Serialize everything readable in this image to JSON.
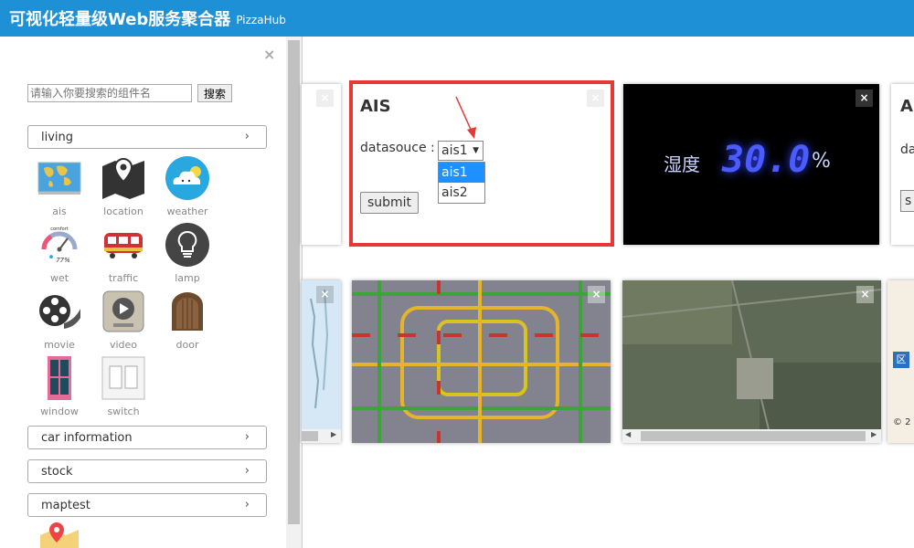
{
  "header": {
    "title": "可视化轻量级Web服务聚合器",
    "subtitle": "PizzaHub"
  },
  "sidebar": {
    "close_glyph": "×",
    "search": {
      "placeholder": "请输入你要搜索的组件名",
      "button": "搜索"
    },
    "categories": [
      {
        "label": "living",
        "chevron": "›"
      },
      {
        "label": "car information",
        "chevron": "›"
      },
      {
        "label": "stock",
        "chevron": "›"
      },
      {
        "label": "maptest",
        "chevron": "›"
      }
    ],
    "components": [
      {
        "label": "ais",
        "icon": "world-map-icon"
      },
      {
        "label": "location",
        "icon": "location-map-icon"
      },
      {
        "label": "weather",
        "icon": "weather-cloud-icon"
      },
      {
        "label": "wet",
        "icon": "humidity-gauge-icon",
        "gauge_text": "comfort",
        "gauge_value": "77%"
      },
      {
        "label": "traffic",
        "icon": "train-icon"
      },
      {
        "label": "lamp",
        "icon": "lightbulb-icon"
      },
      {
        "label": "movie",
        "icon": "film-reel-icon"
      },
      {
        "label": "video",
        "icon": "video-player-icon"
      },
      {
        "label": "door",
        "icon": "door-icon"
      },
      {
        "label": "window",
        "icon": "window-icon"
      },
      {
        "label": "switch",
        "icon": "light-switch-icon"
      }
    ]
  },
  "cards": {
    "ais": {
      "title": "AIS",
      "datasource_label": "datasouce :",
      "selected": "ais1",
      "options": [
        "ais1",
        "ais2"
      ],
      "submit": "submit"
    },
    "humidity": {
      "label": "湿度",
      "value": "30.0",
      "unit": "%"
    },
    "right_partial": {
      "title": "A",
      "label": "da",
      "button": "s"
    },
    "map_label": "区",
    "copyright": "© 2"
  },
  "colors": {
    "header_bg": "#1e90d6",
    "ais_border": "#e53935",
    "dropdown_selected": "#1e90ff",
    "humidity_digits": "#4a5cff"
  }
}
